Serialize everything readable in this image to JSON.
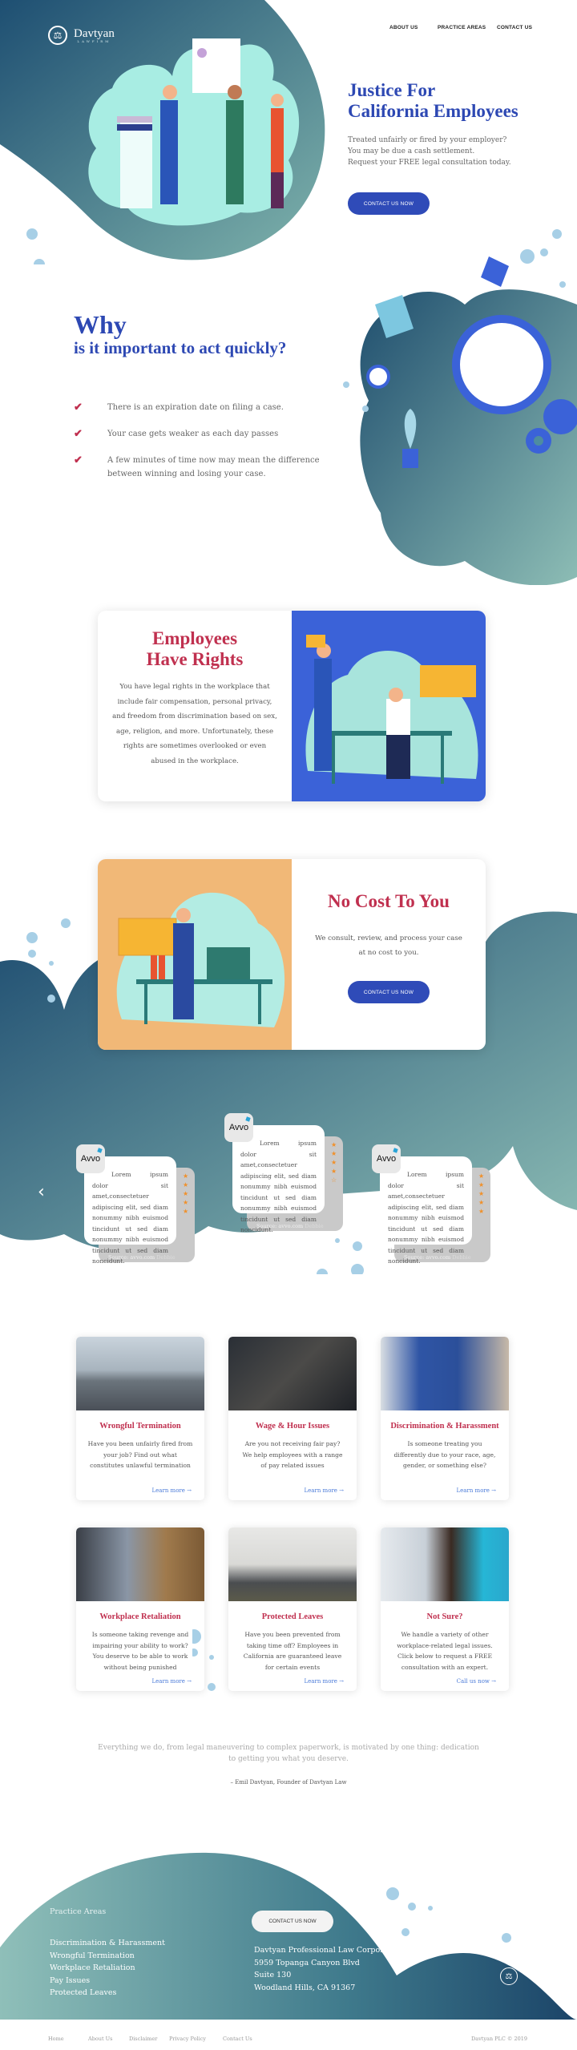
{
  "header": {
    "brand": "Davtyan",
    "brand_sub": "LAWFIRM",
    "nav": [
      "ABOUT US",
      "PRACTICE  AREAS",
      "CONTACT US"
    ]
  },
  "hero": {
    "title_line1": "Justice For",
    "title_line2": "California Employees",
    "text": [
      "Treated unfairly or fired by your employer?",
      "You may be due a cash settlement.",
      "Request your FREE legal consultation today."
    ],
    "cta": "CONTACT US NOW"
  },
  "why": {
    "title_big": "Why",
    "title_small": "is it important to act quickly?",
    "items": [
      "There is an expiration date on filing a case.",
      "Your case gets weaker as each day passes",
      "A few minutes of time now may mean the difference between winning and losing your case."
    ]
  },
  "rights": {
    "title_line1": "Employees",
    "title_line2": "Have Rights",
    "text": "You have legal rights in the workplace that include fair compensation, personal privacy, and freedom from discrimination based on sex, age, religion, and more. Unfortunately, these rights are sometimes overlooked or even abused in the workplace."
  },
  "nocost": {
    "title": "No Cost To You",
    "text_line1": "We consult, review, and process your case",
    "text_line2": "at no cost to you.",
    "cta": "CONTACT US NOW"
  },
  "testimonials": {
    "prev": "‹",
    "next": "›",
    "items": [
      {
        "logo": "Avvo",
        "text": "Lorem ipsum dolor sit amet,consectetuer adipiscing elit, sed diam nonummy nibh euismod tincidunt ut sed diam  nonummy nibh euismod tincidunt ut sed diam  noncidunt.",
        "rating": 5,
        "source": "Source: avvo.com",
        "author": "Debbie"
      },
      {
        "logo": "Avvo",
        "text": "Lorem ipsum dolor sit amet,consectetuer adipiscing elit, sed diam nonummy nibh euismod tincidunt ut sed diam  nonummy nibh euismod tincidunt ut sed diam  noncidunt.",
        "rating": 4,
        "source": "Source: avvo.com",
        "author": "Debbie"
      },
      {
        "logo": "Avvo",
        "text": "Lorem ipsum dolor sit amet,consectetuer adipiscing elit, sed diam nonummy nibh euismod tincidunt ut sed diam  nonummy nibh euismod tincidunt ut sed diam  noncidunt.",
        "rating": 5,
        "source": "Source: avvo.com",
        "author": "Debbie"
      }
    ]
  },
  "practice": [
    {
      "title": "Wrongful Termination",
      "text": "Have you been unfairly fired from your job? Find out what constitutes unlawful termination",
      "link": "Learn more →"
    },
    {
      "title": "Wage & Hour Issues",
      "text": "Are you not receiving fair pay? We help employees with a range of pay related issues",
      "link": "Learn more →"
    },
    {
      "title": "Discrimination & Harassment",
      "text": "Is someone treating you differently due to your race, age, gender, or something else?",
      "link": "Learn more →"
    },
    {
      "title": "Workplace Retaliation",
      "text": "Is someone taking revenge and impairing your ability to work? You deserve to be able to work without being punished",
      "link": "Learn more →"
    },
    {
      "title": "Protected Leaves",
      "text": "Have you been prevented from taking time off? Employees in California are guaranteed leave for certain events",
      "link": "Learn more →"
    },
    {
      "title": "Not Sure?",
      "text": "We handle a variety of other workplace-related legal issues. Click below to request a FREE consultation with an expert.",
      "link": "Call us now →"
    }
  ],
  "quote": {
    "text": "Everything we do, from legal maneuvering to complex paperwork, is motivated by one thing: dedication to getting you what you deserve.",
    "author": "– Emil Davtyan, Founder of Davtyan Law"
  },
  "footer": {
    "heading": "Practice Areas",
    "links": [
      "Discrimination & Harassment",
      "Wrongful Termination",
      "Workplace Retaliation",
      "Pay Issues",
      "Protected Leaves"
    ],
    "cta": "CONTACT US NOW",
    "address": [
      "Davtyan Professional Law Corporation",
      "5959 Topanga Canyon Blvd",
      "Suite 130",
      "Woodland Hills, CA 91367"
    ],
    "bottom_nav": [
      "Home",
      "About Us",
      "Disclaimer",
      "Privacy Policy",
      "Contact Us"
    ],
    "copyright": "Davtyan PLC © 2019"
  },
  "colors": {
    "primary_blue": "#2f4bb8",
    "accent_red": "#c0304f",
    "teal_dark": "#1f4e6e",
    "teal_light": "#8fbfb9",
    "star_orange": "#f0902a",
    "link_blue": "#4a7ad8"
  }
}
